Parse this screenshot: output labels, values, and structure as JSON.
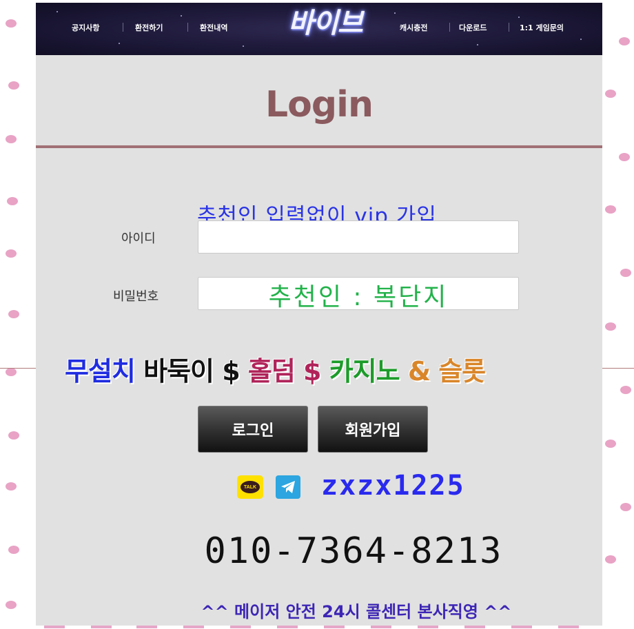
{
  "header": {
    "nav_left": [
      "공지사항",
      "환전하기",
      "환전내역"
    ],
    "logo_text": "바이브",
    "nav_right": [
      "캐시충전",
      "다운로드",
      "1:1 게임문의"
    ]
  },
  "login": {
    "title": "Login",
    "promo_top": "추천인 입력없이 vip 가입",
    "id_label": "아이디",
    "id_value": "",
    "password_label": "비밀번호",
    "password_value": "",
    "recommender_overlay": "추천인 : 복단지"
  },
  "promo_line": {
    "parts": [
      {
        "text": "무설치",
        "color": "#1f2ce0"
      },
      {
        "text": " 바둑이 $ ",
        "color": "#111111"
      },
      {
        "text": "홀덤",
        "color": "#b0245a"
      },
      {
        "text": " $ ",
        "color": "#b0245a"
      },
      {
        "text": "카지노",
        "color": "#1d9b2a"
      },
      {
        "text": " & 슬롯",
        "color": "#d9862a"
      }
    ]
  },
  "buttons": {
    "login_label": "로그인",
    "signup_label": "회원가입"
  },
  "contact": {
    "kakao_icon_text": "TALK",
    "messenger_id": "zxzx1225",
    "phone": "010-7364-8213",
    "footer": "^^ 메이저 안전 24시 콜센터 본사직영 ^^"
  },
  "colors": {
    "page_background": "#e1e1e1",
    "title_color": "#8a5a5e",
    "accent_blue": "#2a2aee",
    "footer_purple": "#3d26b5"
  }
}
